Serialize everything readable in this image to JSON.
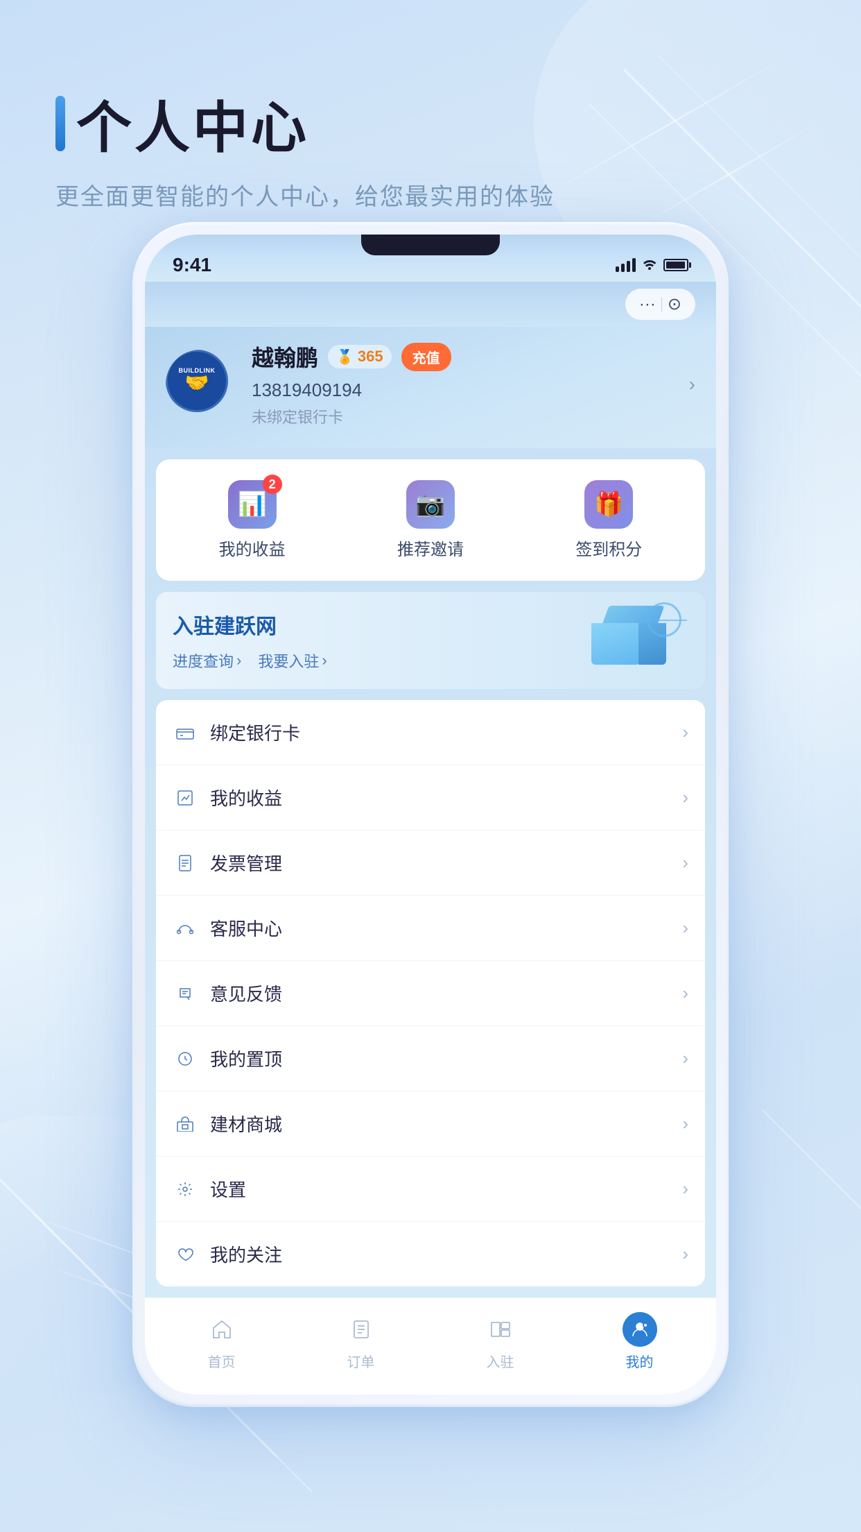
{
  "page": {
    "title": "个人中心",
    "subtitle": "更全面更智能的个人中心，给您最实用的体验"
  },
  "status_bar": {
    "time": "9:41",
    "signal": "signal",
    "wifi": "wifi",
    "battery": "battery"
  },
  "top_bar": {
    "menu_icon": "···",
    "camera_icon": "⊙"
  },
  "profile": {
    "name": "越翰鹏",
    "phone": "13819409194",
    "bank_status": "未绑定银行卡",
    "points": "365",
    "points_icon": "🏅",
    "recharge_label": "充值"
  },
  "quick_access": [
    {
      "icon": "📊",
      "label": "我的收益",
      "badge": "2"
    },
    {
      "icon": "📷",
      "label": "推荐邀请",
      "badge": null
    },
    {
      "icon": "🎁",
      "label": "签到积分",
      "badge": null
    }
  ],
  "banner": {
    "title": "入驻建跃网",
    "link1": "进度查询",
    "link2": "我要入驻"
  },
  "menu_items": [
    {
      "icon": "💳",
      "label": "绑定银行卡"
    },
    {
      "icon": "📈",
      "label": "我的收益"
    },
    {
      "icon": "🧾",
      "label": "发票管理"
    },
    {
      "icon": "🎧",
      "label": "客服中心"
    },
    {
      "icon": "✏️",
      "label": "意见反馈"
    },
    {
      "icon": "⬆️",
      "label": "我的置顶"
    },
    {
      "icon": "🏪",
      "label": "建材商城"
    },
    {
      "icon": "⚙️",
      "label": "设置"
    },
    {
      "icon": "❤️",
      "label": "我的关注"
    }
  ],
  "bottom_nav": [
    {
      "icon": "🏠",
      "label": "首页",
      "active": false
    },
    {
      "icon": "📋",
      "label": "订单",
      "active": false
    },
    {
      "icon": "🏢",
      "label": "入驻",
      "active": false
    },
    {
      "icon": "👤",
      "label": "我的",
      "active": true
    }
  ]
}
